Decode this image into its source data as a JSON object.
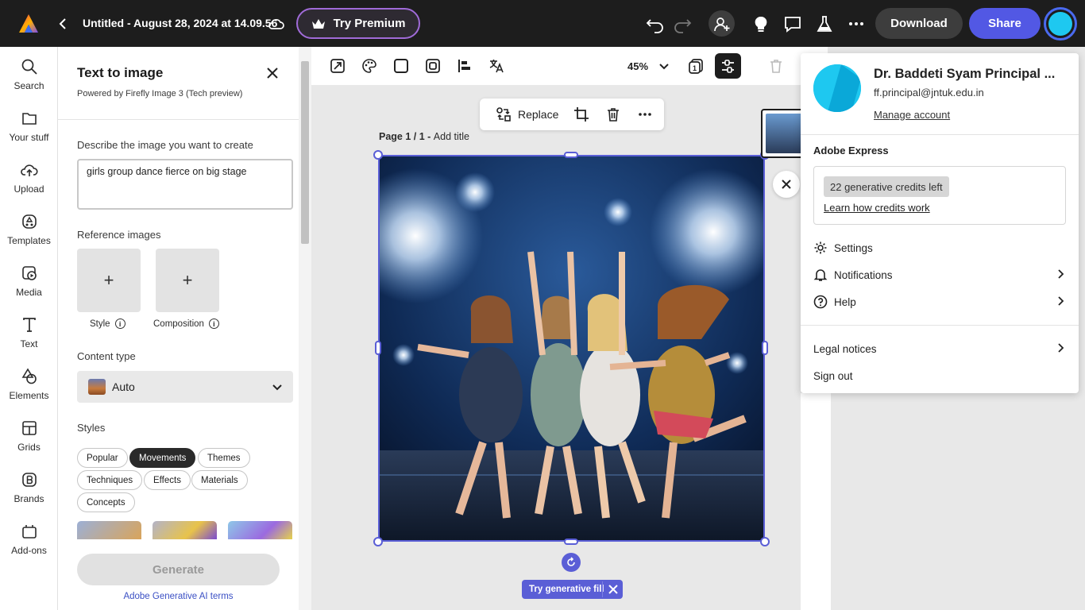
{
  "header": {
    "doc_title": "Untitled - August 28, 2024 at 14.09.56",
    "premium_label": "Try Premium",
    "download_label": "Download",
    "share_label": "Share"
  },
  "leftnav": {
    "items": [
      {
        "label": "Search"
      },
      {
        "label": "Your stuff"
      },
      {
        "label": "Upload"
      },
      {
        "label": "Templates"
      },
      {
        "label": "Media"
      },
      {
        "label": "Text"
      },
      {
        "label": "Elements"
      },
      {
        "label": "Grids"
      },
      {
        "label": "Brands"
      },
      {
        "label": "Add-ons"
      }
    ]
  },
  "panel": {
    "title": "Text to image",
    "subtitle": "Powered by Firefly Image 3 (Tech preview)",
    "describe_label": "Describe the image you want to create",
    "prompt_value": "girls group dance fierce on big stage",
    "reference_label": "Reference images",
    "ref_style_label": "Style",
    "ref_composition_label": "Composition",
    "content_type_label": "Content type",
    "content_type_value": "Auto",
    "styles_label": "Styles",
    "chips": [
      "Popular",
      "Movements",
      "Themes",
      "Techniques",
      "Effects",
      "Materials",
      "Concepts"
    ],
    "active_chip": "Movements",
    "generate_label": "Generate",
    "terms_link": "Adobe Generative AI terms"
  },
  "canvas": {
    "zoom": "45%",
    "replace_label": "Replace",
    "page_label_prefix": "Page 1 / 1 - ",
    "page_title_placeholder": "Add title",
    "gen_fill_label": "Try generative fill"
  },
  "account": {
    "name": "Dr. Baddeti Syam Principal ...",
    "email": "ff.principal@jntuk.edu.in",
    "manage": "Manage account",
    "section": "Adobe Express",
    "credits": "22 generative credits left",
    "credits_link": "Learn how credits work",
    "settings": "Settings",
    "notifications": "Notifications",
    "help": "Help",
    "legal": "Legal notices",
    "signout": "Sign out"
  },
  "colors": {
    "accent": "#5a5ed6",
    "share_button": "#5258e4",
    "avatar": "#1ec8f0",
    "topbar": "#1d1d1d"
  }
}
